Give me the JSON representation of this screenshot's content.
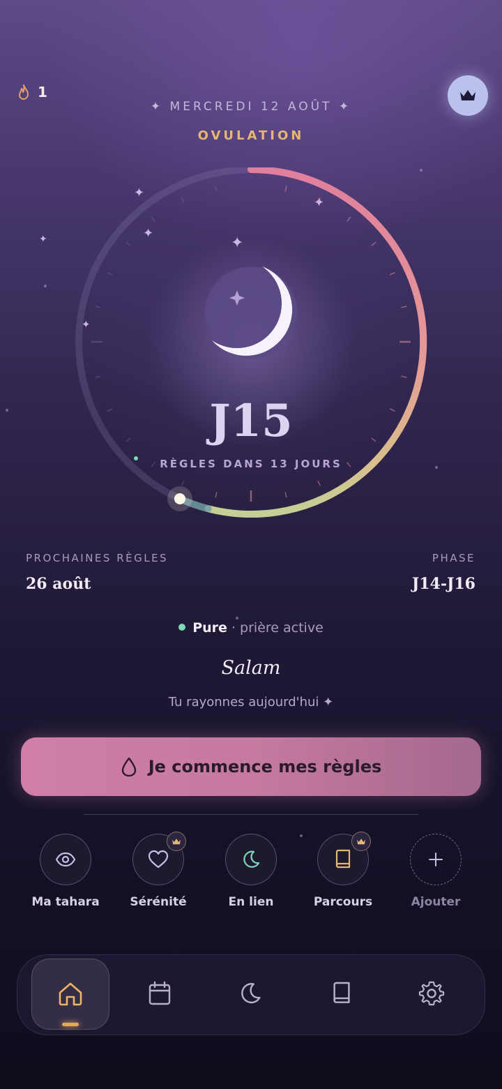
{
  "header": {
    "streak_count": "1",
    "date": "✦ MERCREDI 12 AOÛT ✦",
    "phase": "OVULATION"
  },
  "cycle": {
    "day_label": "J15",
    "next_period_text": "RÈGLES DANS 13 JOURS",
    "progress_fraction": 0.54
  },
  "info": {
    "next_period_label": "PROCHAINES RÈGLES",
    "next_period_value": "26 août",
    "phase_label": "PHASE",
    "phase_value": "J14-J16"
  },
  "status": {
    "state": "Pure",
    "detail": " · prière active"
  },
  "greeting": {
    "title": "Salam",
    "subtitle": "Tu rayonnes aujourd'hui ✦"
  },
  "cta": {
    "label": "Je commence mes règles"
  },
  "shortcuts": [
    {
      "label": "Ma tahara",
      "icon": "eye-icon",
      "premium": false
    },
    {
      "label": "Sérénité",
      "icon": "heart-icon",
      "premium": true
    },
    {
      "label": "En lien",
      "icon": "moon-icon",
      "premium": false
    },
    {
      "label": "Parcours",
      "icon": "book-icon",
      "premium": true
    },
    {
      "label": "Ajouter",
      "icon": "plus-icon",
      "premium": false
    }
  ],
  "nav": [
    {
      "icon": "home-icon",
      "active": true
    },
    {
      "icon": "calendar-icon",
      "active": false
    },
    {
      "icon": "moon-icon",
      "active": false
    },
    {
      "icon": "book-icon",
      "active": false
    },
    {
      "icon": "gear-icon",
      "active": false
    }
  ],
  "colors": {
    "accent_gold": "#e5b674",
    "cta_pink": "#d07ea8",
    "pure_green": "#7fd9b3",
    "crown_bg": "#b9c1ec"
  }
}
